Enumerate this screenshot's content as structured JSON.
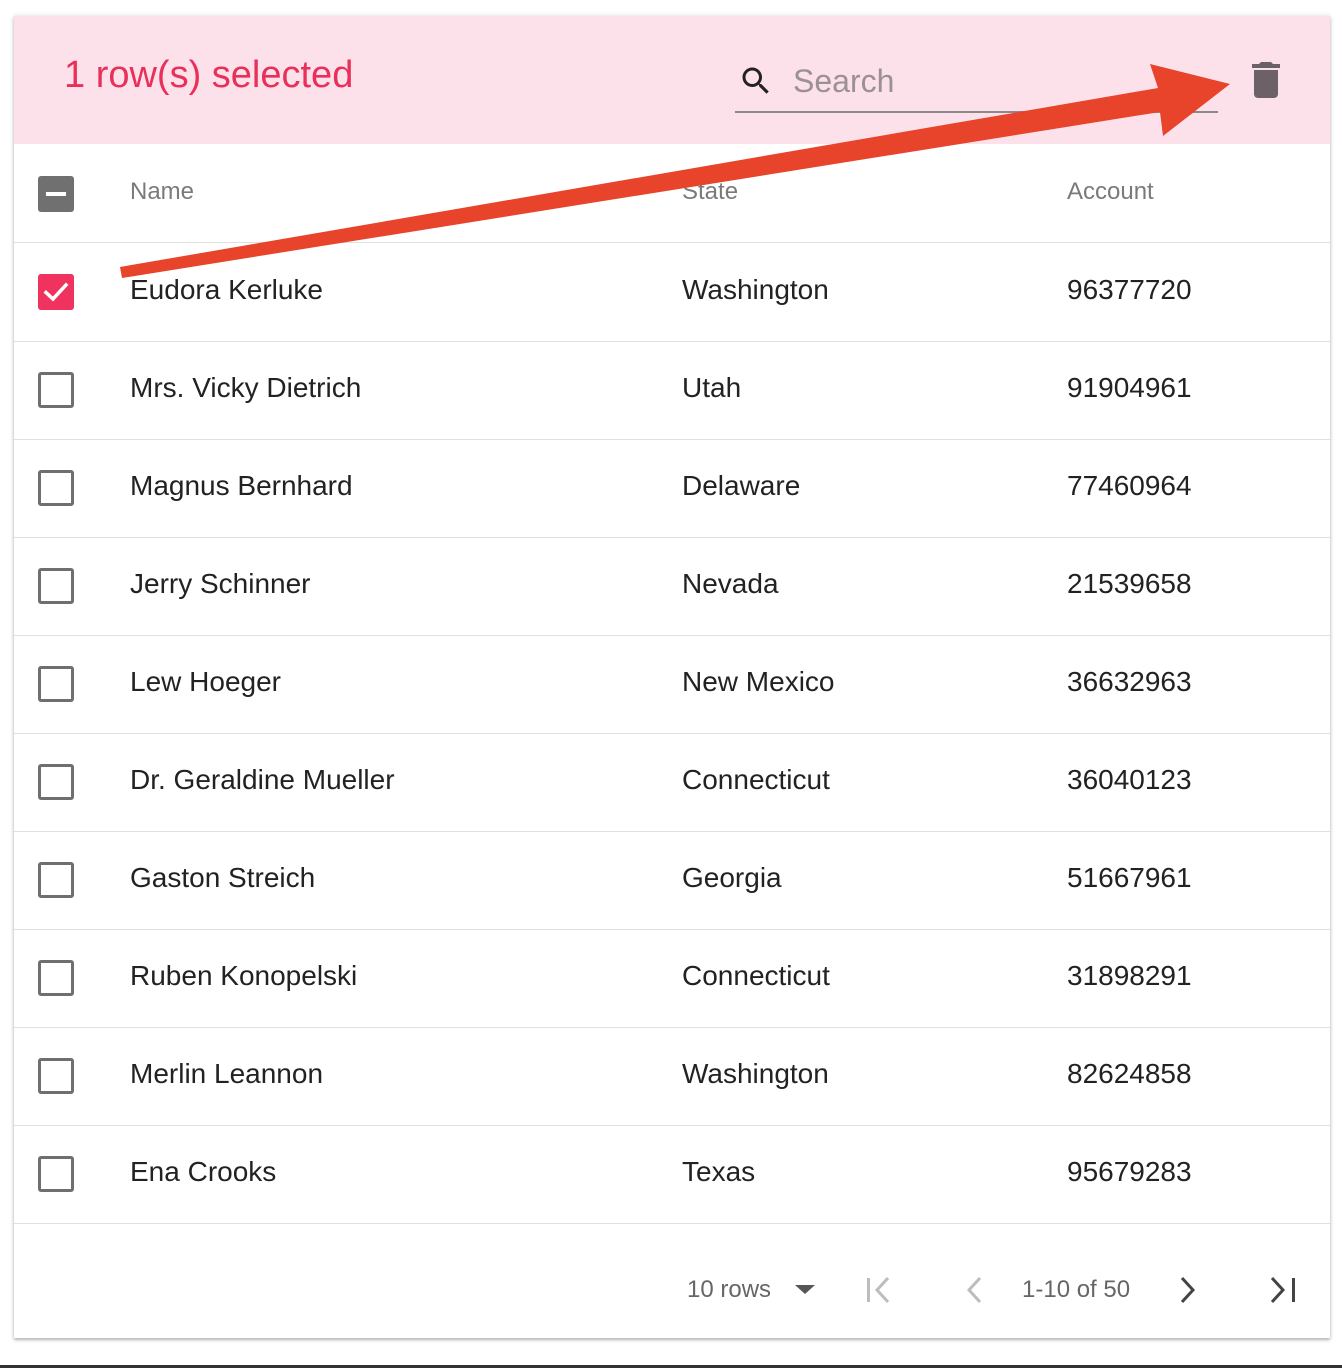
{
  "toolbar": {
    "title": "1 row(s) selected",
    "search_placeholder": "Search",
    "search_value": ""
  },
  "table": {
    "headers": {
      "name": "Name",
      "state": "State",
      "account": "Account"
    },
    "select_all_state": "indeterminate",
    "rows": [
      {
        "name": "Eudora Kerluke",
        "state": "Washington",
        "account": "96377720",
        "selected": true
      },
      {
        "name": "Mrs. Vicky Dietrich",
        "state": "Utah",
        "account": "91904961",
        "selected": false
      },
      {
        "name": "Magnus Bernhard",
        "state": "Delaware",
        "account": "77460964",
        "selected": false
      },
      {
        "name": "Jerry Schinner",
        "state": "Nevada",
        "account": "21539658",
        "selected": false
      },
      {
        "name": "Lew Hoeger",
        "state": "New Mexico",
        "account": "36632963",
        "selected": false
      },
      {
        "name": "Dr. Geraldine Mueller",
        "state": "Connecticut",
        "account": "36040123",
        "selected": false
      },
      {
        "name": "Gaston Streich",
        "state": "Georgia",
        "account": "51667961",
        "selected": false
      },
      {
        "name": "Ruben Konopelski",
        "state": "Connecticut",
        "account": "31898291",
        "selected": false
      },
      {
        "name": "Merlin Leannon",
        "state": "Washington",
        "account": "82624858",
        "selected": false
      },
      {
        "name": "Ena Crooks",
        "state": "Texas",
        "account": "95679283",
        "selected": false
      }
    ]
  },
  "pagination": {
    "rows_per_page": "10 rows",
    "range": "1-10 of 50"
  },
  "icons": {
    "search": "search-icon",
    "delete": "trash-icon",
    "first_page": "first-page-icon",
    "previous_page": "chevron-left-icon",
    "next_page": "chevron-right-icon",
    "last_page": "last-page-icon",
    "dropdown": "arrow-drop-down-icon",
    "annotation": "red-arrow-annotation"
  },
  "colors": {
    "accent": "#f0325e",
    "selection_bar": "#fde1ea",
    "annotation_arrow": "#e8432b"
  }
}
